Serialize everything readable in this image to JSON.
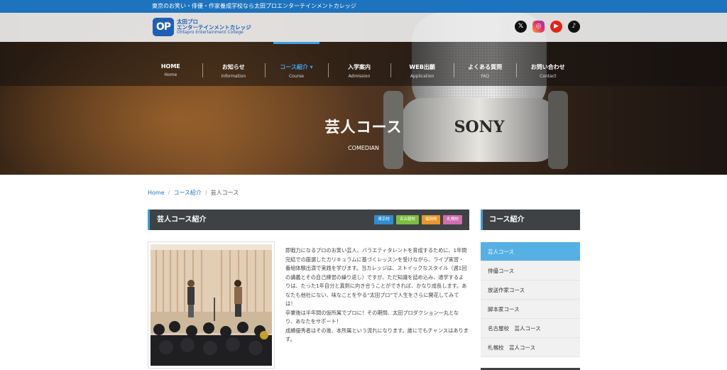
{
  "topbar": {
    "text": "東京のお笑い・俳優・作家養成学校なら太田プロエンターテインメントカレッジ"
  },
  "logo": {
    "mark": "OP",
    "line1": "太田プロ",
    "line2": "エンターテインメントカレッジ",
    "line3": "Ohtapro Entertainment College"
  },
  "social": [
    {
      "name": "x-icon",
      "glyph": "𝕏"
    },
    {
      "name": "instagram-icon",
      "glyph": "◎"
    },
    {
      "name": "youtube-icon",
      "glyph": "▶"
    },
    {
      "name": "tiktok-icon",
      "glyph": "♪"
    }
  ],
  "nav": [
    {
      "jp": "HOME",
      "en": "Home"
    },
    {
      "jp": "お知らせ",
      "en": "Information"
    },
    {
      "jp": "コース紹介 ▾",
      "en": "Course",
      "active": true
    },
    {
      "jp": "入学案内",
      "en": "Admission"
    },
    {
      "jp": "WEB出願",
      "en": "Application"
    },
    {
      "jp": "よくある質問",
      "en": "FAQ"
    },
    {
      "jp": "お問い合わせ",
      "en": "Contact"
    }
  ],
  "hero": {
    "title": "芸人コース",
    "subtitle": "COMEDIAN",
    "mic_brand": "SONY"
  },
  "breadcrumb": {
    "home": "Home",
    "sep": "/",
    "course": "コース紹介",
    "current": "芸人コース"
  },
  "section": {
    "title": "芸人コース紹介",
    "badges": [
      {
        "label": "東京校",
        "color": "#2d8ed0"
      },
      {
        "label": "名古屋校",
        "color": "#7cbd3f"
      },
      {
        "label": "福岡校",
        "color": "#e8972a"
      },
      {
        "label": "札幌校",
        "color": "#cf6fb0"
      }
    ]
  },
  "description": [
    "即戦力になるプロのお笑い芸人、バラエティタレントを育成するために、1年間完結での厳選したカリキュラムに基づくレッスンを受けながら、ライブ実習・番組体験出演で実践を学びます。当カレッジは、ストイックなスタイル（週1回の講義とその自己練習の繰り返し）ですが、ただ知識を詰め込み、通学するよりは、たった1年自分と真剣に向き合うことができれば、かなり成長します。あなたも他社にない、味なことをやる“太田プロ”で人生をさらに開花してみては！",
    "卒業後は半年間の仮所属でプロに！その期間、太田プロダクション一丸となり、あなたをサポート！",
    "成績優秀者はその後、本所属という流れになります。誰にでもチャンスはあります。"
  ],
  "sidebar": {
    "title": "コース紹介",
    "items": [
      {
        "label": "芸人コース",
        "active": true
      },
      {
        "label": "俳優コース"
      },
      {
        "label": "放送作家コース"
      },
      {
        "label": "脚本家コース"
      },
      {
        "label": "名古屋校　芸人コース"
      },
      {
        "label": "札幌校　芸人コース"
      }
    ]
  }
}
